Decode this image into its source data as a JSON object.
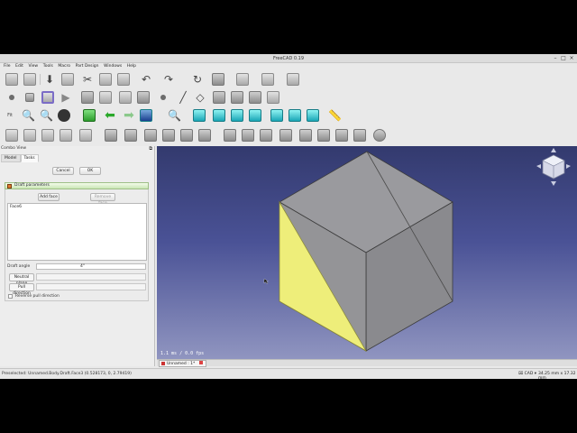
{
  "window": {
    "title": "FreeCAD 0.19"
  },
  "menu": [
    "File",
    "Edit",
    "View",
    "Tools",
    "Macro",
    "Part Design",
    "Windows",
    "Help"
  ],
  "workbench": {
    "selected": "Part Design"
  },
  "combo": {
    "title": "Combo View",
    "tabs": [
      "Model",
      "Tasks"
    ],
    "cancel": "Cancel",
    "ok": "OK",
    "panel_title": "Draft parameters",
    "add_face": "Add face",
    "remove_face": "Remove face",
    "faces": [
      "Face6"
    ],
    "draft_angle_label": "Draft angle",
    "draft_angle_value": "4°",
    "neutral_plane": "Neutral plane",
    "pull_direction": "Pull direction",
    "reverse": "Reverse pull direction"
  },
  "viewport": {
    "fps": "1.1 ms / 0.0 fps"
  },
  "doc_tab": {
    "label": "Unnamed : 1*"
  },
  "status": {
    "message": "Preselected: Unnamed.Body.Draft.Face3 (0.528173, 0, 2.79419)",
    "nav": "CAD",
    "dims": "34.25 mm x 17.32 mm"
  },
  "colors": {
    "viewport_top": "#333a6e",
    "viewport_bottom": "#9095c0",
    "face_highlight": "#f2f28a",
    "panel_green": "#c9e6b5"
  }
}
